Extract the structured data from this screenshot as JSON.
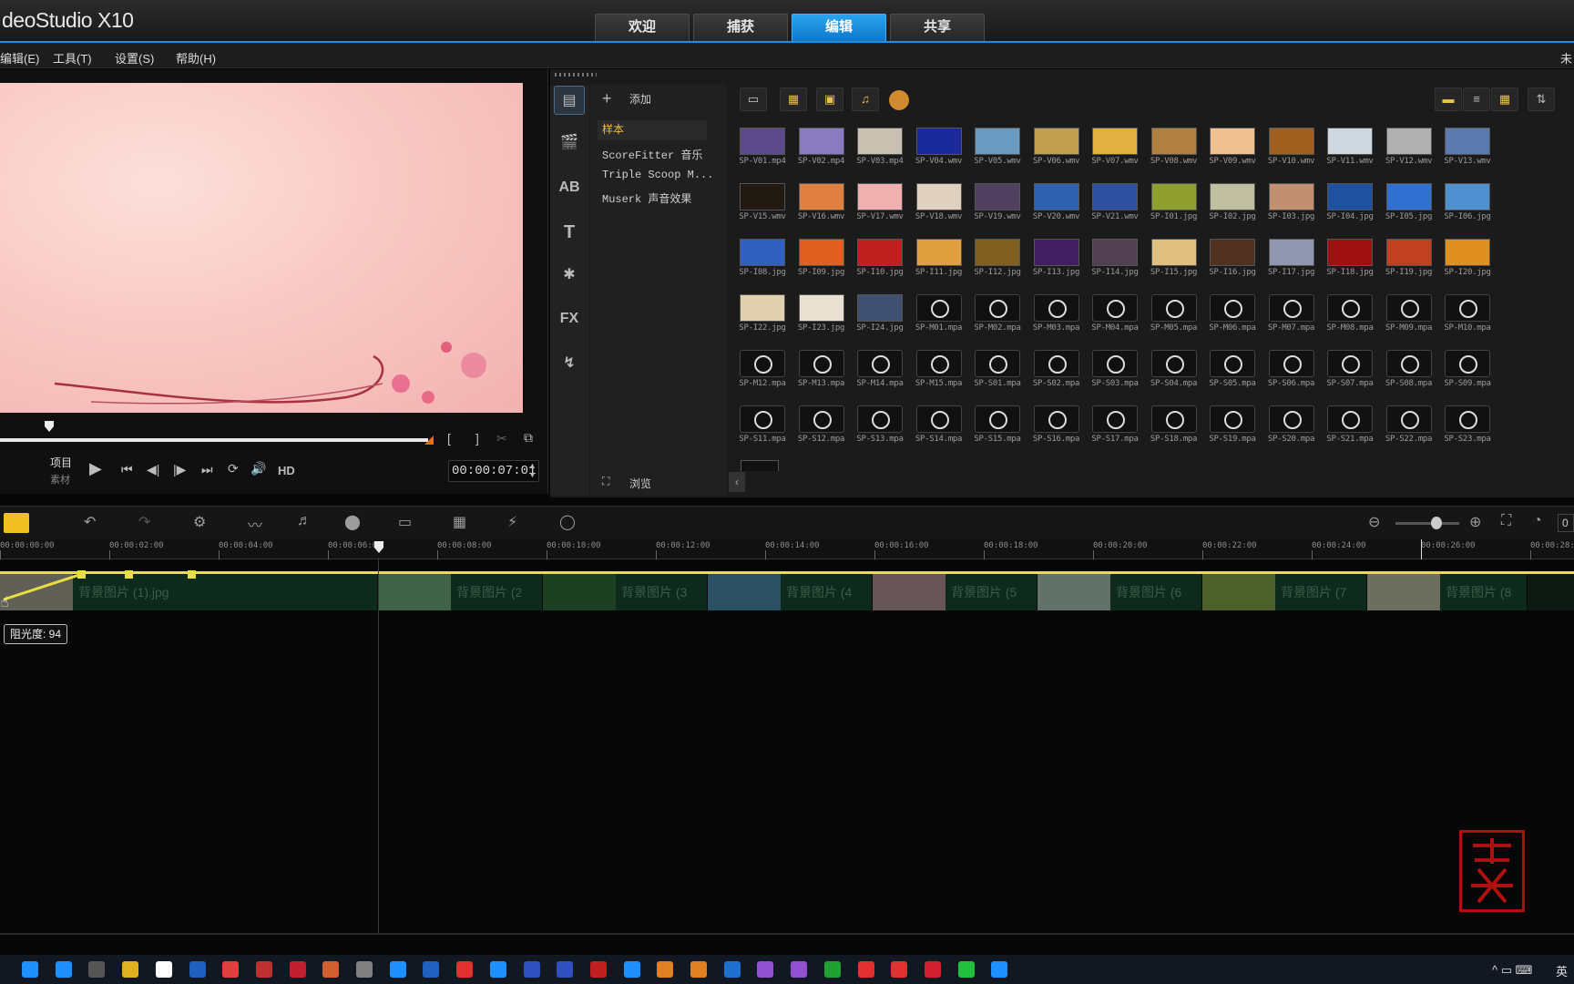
{
  "app": {
    "title": "deoStudio X10"
  },
  "tabs": [
    {
      "label": "欢迎"
    },
    {
      "label": "捕获"
    },
    {
      "label": "编辑"
    },
    {
      "label": "共享"
    }
  ],
  "menu": [
    {
      "label": "编辑(E)"
    },
    {
      "label": "工具(T)"
    },
    {
      "label": "设置(S)"
    },
    {
      "label": "帮助(H)"
    }
  ],
  "corner_text": "未",
  "player": {
    "mode_project": "项目",
    "mode_clip": "素材",
    "hd": "HD",
    "timecode": "00:00:07:01",
    "mark_in": "[",
    "mark_out": "]"
  },
  "library": {
    "add_label": "添加",
    "browse_label": "浏览",
    "folders": [
      {
        "label": "样本"
      },
      {
        "label": "ScoreFitter 音乐"
      },
      {
        "label": "Triple Scoop M..."
      },
      {
        "label": "Muserk 声音效果"
      }
    ],
    "categories": [
      "media",
      "instant-project",
      "transition",
      "title",
      "graphic",
      "FX",
      "path"
    ],
    "fx_label": "FX",
    "title_label": "T",
    "thumbs": [
      "SP-V01.mp4",
      "SP-V02.mp4",
      "SP-V03.mp4",
      "SP-V04.wmv",
      "SP-V05.wmv",
      "SP-V06.wmv",
      "SP-V07.wmv",
      "SP-V08.wmv",
      "SP-V09.wmv",
      "SP-V10.wmv",
      "SP-V11.wmv",
      "SP-V12.wmv",
      "SP-V13.wmv",
      "SP-V15.wmv",
      "SP-V16.wmv",
      "SP-V17.wmv",
      "SP-V18.wmv",
      "SP-V19.wmv",
      "SP-V20.wmv",
      "SP-V21.wmv",
      "SP-I01.jpg",
      "SP-I02.jpg",
      "SP-I03.jpg",
      "SP-I04.jpg",
      "SP-I05.jpg",
      "SP-I06.jpg",
      "SP-I08.jpg",
      "SP-I09.jpg",
      "SP-I10.jpg",
      "SP-I11.jpg",
      "SP-I12.jpg",
      "SP-I13.jpg",
      "SP-I14.jpg",
      "SP-I15.jpg",
      "SP-I16.jpg",
      "SP-I17.jpg",
      "SP-I18.jpg",
      "SP-I19.jpg",
      "SP-I20.jpg",
      "SP-I22.jpg",
      "SP-I23.jpg",
      "SP-I24.jpg",
      "SP-M01.mpa",
      "SP-M02.mpa",
      "SP-M03.mpa",
      "SP-M04.mpa",
      "SP-M05.mpa",
      "SP-M06.mpa",
      "SP-M07.mpa",
      "SP-M08.mpa",
      "SP-M09.mpa",
      "SP-M10.mpa",
      "SP-M12.mpa",
      "SP-M13.mpa",
      "SP-M14.mpa",
      "SP-M15.mpa",
      "SP-S01.mpa",
      "SP-S02.mpa",
      "SP-S03.mpa",
      "SP-S04.mpa",
      "SP-S05.mpa",
      "SP-S06.mpa",
      "SP-S07.mpa",
      "SP-S08.mpa",
      "SP-S09.mpa",
      "SP-S11.mpa",
      "SP-S12.mpa",
      "SP-S13.mpa",
      "SP-S14.mpa",
      "SP-S15.mpa",
      "SP-S16.mpa",
      "SP-S17.mpa",
      "SP-S18.mpa",
      "SP-S19.mpa",
      "SP-S20.mpa",
      "SP-S21.mpa",
      "SP-S22.mpa",
      "SP-S23.mpa"
    ]
  },
  "timeline": {
    "ruler": [
      "00:00:00:00",
      "00:00:02:00",
      "00:00:04:00",
      "00:00:06:00",
      "00:00:08:00",
      "00:00:10:00",
      "00:00:12:00",
      "00:00:14:00",
      "00:00:16:00",
      "00:00:18:00",
      "00:00:20:00",
      "00:00:22:00",
      "00:00:24:00",
      "00:00:26:00",
      "00:00:28:00"
    ],
    "clips": [
      {
        "name": "背景图片 (1).jpg",
        "color": "#c8a2a0"
      },
      {
        "name": "背景图片 (2",
        "color": "#7fa67a"
      },
      {
        "name": "背景图片 (3",
        "color": "#2f5e2a"
      },
      {
        "name": "背景图片 (4",
        "color": "#4f7fb6"
      },
      {
        "name": "背景图片 (5",
        "color": "#d88aa0"
      },
      {
        "name": "背景图片 (6",
        "color": "#c9c9c9"
      },
      {
        "name": "背景图片 (7",
        "color": "#9aa23a"
      },
      {
        "name": "背景图片 (8",
        "color": "#e0c0b0"
      }
    ],
    "tooltip": "阻光度: 94",
    "zoom_value": "0"
  },
  "seal_text": "老萧"
}
